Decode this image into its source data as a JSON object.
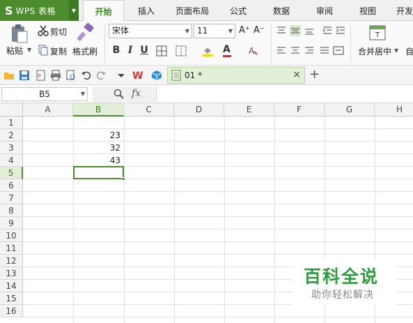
{
  "app": {
    "logo_glyph": "S",
    "name": "WPS 表格",
    "brand_color": "#4d8c2c"
  },
  "menu_tabs": [
    {
      "label": "开始",
      "active": true
    },
    {
      "label": "插入",
      "active": false
    },
    {
      "label": "页面布局",
      "active": false
    },
    {
      "label": "公式",
      "active": false
    },
    {
      "label": "数据",
      "active": false
    },
    {
      "label": "审阅",
      "active": false
    },
    {
      "label": "视图",
      "active": false
    },
    {
      "label": "开发",
      "active": false
    }
  ],
  "ribbon": {
    "paste_label": "粘贴",
    "cut_label": "剪切",
    "copy_label": "复制",
    "format_painter_label": "格式刷",
    "font_name": "宋体",
    "font_size": "11",
    "grow_font_glyph": "A⁺",
    "shrink_font_glyph": "A⁻",
    "bold": "B",
    "italic": "I",
    "underline": "U",
    "merge_center_label": "合并居中",
    "autowrap_label": "自"
  },
  "quickbar": {
    "doc_tab_title": "01 *",
    "close_glyph": "×",
    "new_tab_glyph": "+"
  },
  "formula_bar": {
    "name_box": "B5",
    "fx_label": "fx",
    "formula_value": ""
  },
  "sheet": {
    "columns": [
      "A",
      "B",
      "C",
      "D",
      "E",
      "F",
      "G",
      "H"
    ],
    "rows": [
      "1",
      "2",
      "3",
      "4",
      "5",
      "6",
      "7",
      "8",
      "9",
      "10",
      "11",
      "12",
      "13",
      "14",
      "15",
      "16"
    ],
    "selected_cell": "B5",
    "cells": {
      "B2": "23",
      "B3": "32",
      "B4": "43"
    }
  },
  "watermark": {
    "title": "百科全说",
    "subtitle": "助你轻松解决",
    "color": "#2f9d3f"
  }
}
